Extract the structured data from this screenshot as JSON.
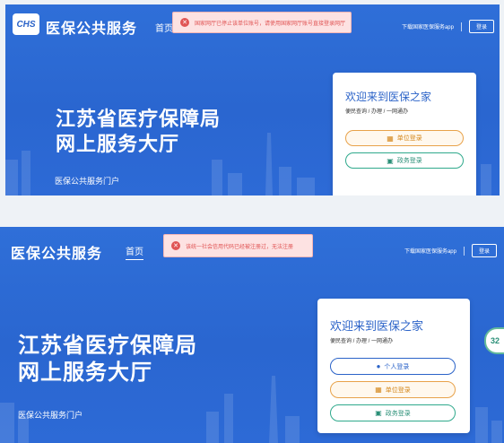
{
  "panels": [
    {
      "logo_text": "CHS",
      "brand": "医保公共服务",
      "nav_home": "首页",
      "toast_icon": "x-circle-icon",
      "toast_message": "国家网厅已停止该单位账号，请使用国家网厅账号直接登录网厅",
      "download_app": "下载国家医保服务app",
      "register": "登录",
      "hero_line1": "江苏省医疗保障局",
      "hero_line2": "网上服务大厅",
      "portal": "医保公共服务门户",
      "card": {
        "title": "欢迎来到医保之家",
        "subtitle": "便民查询 / 办理 / 一网通办",
        "buttons": [
          {
            "label": "单位登录",
            "style": "orange",
            "icon": "building-icon"
          },
          {
            "label": "政务登录",
            "style": "green",
            "icon": "gov-icon"
          }
        ]
      }
    },
    {
      "brand": "医保公共服务",
      "nav_home": "首页",
      "toast_icon": "x-circle-icon",
      "toast_message": "该统一社会信用代码已经被注册过，无法注册",
      "download_app": "下载国家医保服务app",
      "register": "登录",
      "hero_line1": "江苏省医疗保障局",
      "hero_line2": "网上服务大厅",
      "portal": "医保公共服务门户",
      "side_badge": "32",
      "card": {
        "title": "欢迎来到医保之家",
        "subtitle": "便民查询 / 办理 / 一网通办",
        "buttons": [
          {
            "label": "个人登录",
            "style": "blue",
            "icon": "person-icon"
          },
          {
            "label": "单位登录",
            "style": "orange",
            "icon": "building-icon"
          },
          {
            "label": "政务登录",
            "style": "green",
            "icon": "gov-icon"
          }
        ]
      }
    }
  ],
  "colors": {
    "primary": "#2b63c8",
    "error": "#e05454",
    "orange": "#e8a24a",
    "green": "#2fa98c"
  }
}
